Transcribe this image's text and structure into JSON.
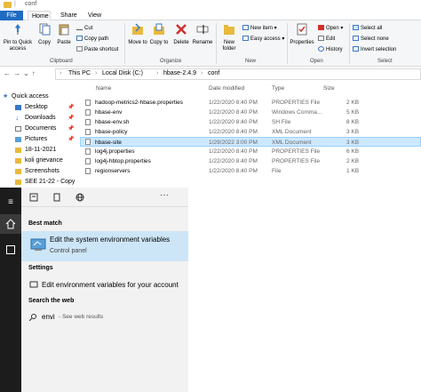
{
  "window": {
    "title": "conf"
  },
  "tabs": [
    "File",
    "Home",
    "Share",
    "View"
  ],
  "ribbon": {
    "clipboard": {
      "pin": "Pin to Quick access",
      "copy": "Copy",
      "paste": "Paste",
      "cut": "Cut",
      "copy_path": "Copy path",
      "paste_shortcut": "Paste shortcut",
      "group": "Clipboard"
    },
    "organize": {
      "move_to": "Move to",
      "copy_to": "Copy to",
      "delete": "Delete",
      "rename": "Rename",
      "group": "Organize"
    },
    "new": {
      "new_folder": "New folder",
      "new_item": "New item",
      "easy_access": "Easy access",
      "group": "New"
    },
    "open": {
      "properties": "Properties",
      "open": "Open",
      "edit": "Edit",
      "history": "History",
      "group": "Open"
    },
    "select": {
      "select_all": "Select all",
      "select_none": "Select none",
      "invert": "Invert selection",
      "group": "Select"
    }
  },
  "address": {
    "this_pc": "This PC",
    "disk": "Local Disk (C:)",
    "hbase": "hbase-2.4.9",
    "conf": "conf"
  },
  "nav": {
    "quick_access": "Quick access",
    "items": [
      "Desktop",
      "Downloads",
      "Documents",
      "Pictures",
      "18-11-2021",
      "koli grievance",
      "Screenshots",
      "SEE 21-22 - Copy"
    ]
  },
  "columns": {
    "name": "Name",
    "date": "Date modified",
    "type": "Type",
    "size": "Size"
  },
  "files": [
    {
      "name": "hadoop-metrics2-hbase.properties",
      "date": "1/22/2020 8:40 PM",
      "type": "PROPERTIES File",
      "size": "2 KB"
    },
    {
      "name": "hbase-env",
      "date": "1/22/2020 8:40 PM",
      "type": "Windows Comma...",
      "size": "5 KB"
    },
    {
      "name": "hbase-env.sh",
      "date": "1/22/2020 8:40 PM",
      "type": "SH File",
      "size": "8 KB"
    },
    {
      "name": "hbase-policy",
      "date": "1/22/2020 8:40 PM",
      "type": "XML Document",
      "size": "3 KB"
    },
    {
      "name": "hbase-site",
      "date": "1/29/2022 3:00 PM",
      "type": "XML Document",
      "size": "3 KB"
    },
    {
      "name": "log4j.properties",
      "date": "1/22/2020 8:40 PM",
      "type": "PROPERTIES File",
      "size": "6 KB"
    },
    {
      "name": "log4j-hbtop.properties",
      "date": "1/22/2020 8:40 PM",
      "type": "PROPERTIES File",
      "size": "2 KB"
    },
    {
      "name": "regionservers",
      "date": "1/22/2020 8:40 PM",
      "type": "File",
      "size": "1 KB"
    }
  ],
  "search": {
    "best_match": "Best match",
    "best_title": "Edit the system environment variables",
    "best_sub": "Control panel",
    "settings": "Settings",
    "settings_item": "Edit environment variables for your account",
    "search_web": "Search the web",
    "query": "envi",
    "web_suffix": "- See web results"
  },
  "colors": {
    "accent": "#1f6bc1",
    "selection": "#cce8ff",
    "start_dark": "#1c1c1c",
    "best_match_bg": "#cde6f7"
  }
}
